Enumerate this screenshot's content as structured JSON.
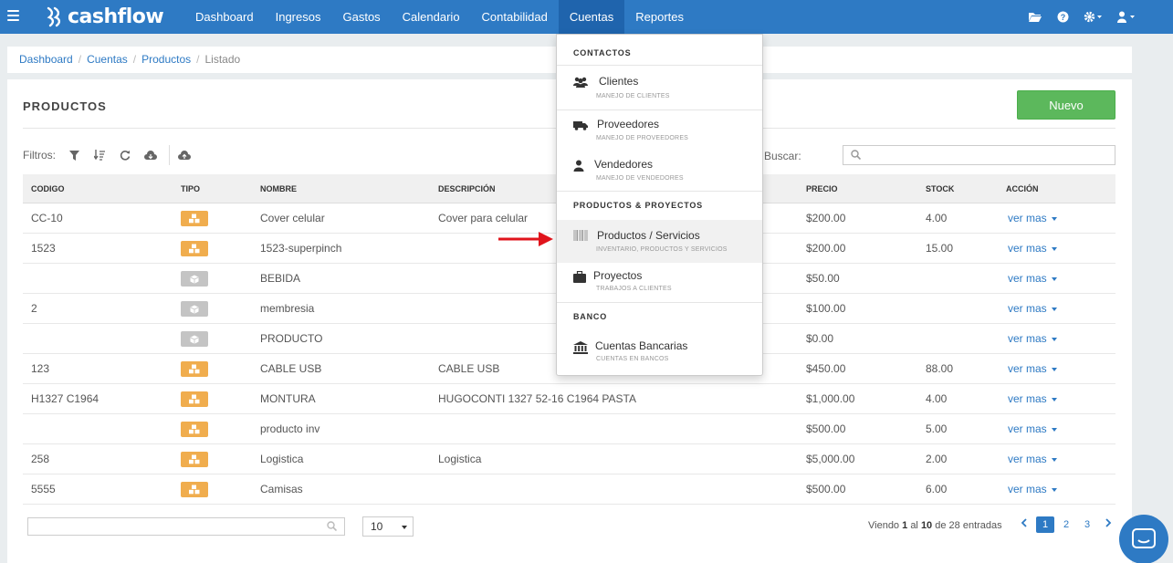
{
  "brand": {
    "name": "cashflow"
  },
  "nav": {
    "items": [
      {
        "label": "Dashboard"
      },
      {
        "label": "Ingresos"
      },
      {
        "label": "Gastos"
      },
      {
        "label": "Calendario"
      },
      {
        "label": "Contabilidad"
      },
      {
        "label": "Cuentas",
        "active": true
      },
      {
        "label": "Reportes"
      }
    ],
    "right_icons": [
      "folder-icon",
      "help-icon",
      "gear-icon",
      "user-icon"
    ]
  },
  "breadcrumb": {
    "items": [
      "Dashboard",
      "Cuentas",
      "Productos"
    ],
    "current": "Listado"
  },
  "panel": {
    "title": "PRODUCTOS",
    "new_button": "Nuevo",
    "filters_label": "Filtros:",
    "search_label": "Buscar:"
  },
  "table": {
    "headers": {
      "codigo": "CODIGO",
      "tipo": "TIPO",
      "nombre": "NOMBRE",
      "descripcion": "DESCRIPCIÓN",
      "precio": "PRECIO",
      "stock": "STOCK",
      "accion": "ACCIÓN"
    },
    "action_label": "ver mas",
    "rows": [
      {
        "codigo": "CC-10",
        "tipo": "product",
        "nombre": "Cover celular",
        "descripcion": "Cover para celular",
        "precio": "$200.00",
        "stock": "4.00"
      },
      {
        "codigo": "1523",
        "tipo": "product",
        "nombre": "1523-superpinch",
        "descripcion": "",
        "precio": "$200.00",
        "stock": "15.00"
      },
      {
        "codigo": "",
        "tipo": "service",
        "nombre": "BEBIDA",
        "descripcion": "",
        "precio": "$50.00",
        "stock": ""
      },
      {
        "codigo": "2",
        "tipo": "service",
        "nombre": "membresia",
        "descripcion": "",
        "precio": "$100.00",
        "stock": ""
      },
      {
        "codigo": "",
        "tipo": "service",
        "nombre": "PRODUCTO",
        "descripcion": "",
        "precio": "$0.00",
        "stock": ""
      },
      {
        "codigo": "123",
        "tipo": "product",
        "nombre": "CABLE USB",
        "descripcion": "CABLE USB",
        "precio": "$450.00",
        "stock": "88.00"
      },
      {
        "codigo": "H1327 C1964",
        "tipo": "product",
        "nombre": "MONTURA",
        "descripcion": "HUGOCONTI 1327 52-16 C1964 PASTA",
        "precio": "$1,000.00",
        "stock": "4.00"
      },
      {
        "codigo": "",
        "tipo": "product",
        "nombre": "producto inv",
        "descripcion": "",
        "precio": "$500.00",
        "stock": "5.00"
      },
      {
        "codigo": "258",
        "tipo": "product",
        "nombre": "Logistica",
        "descripcion": "Logistica",
        "precio": "$5,000.00",
        "stock": "2.00"
      },
      {
        "codigo": "5555",
        "tipo": "product",
        "nombre": "Camisas",
        "descripcion": "",
        "precio": "$500.00",
        "stock": "6.00"
      }
    ]
  },
  "footer": {
    "page_size": "10",
    "info_prefix": "Viendo",
    "info_from": "1",
    "info_mid": "al",
    "info_to": "10",
    "info_suffix": "de 28 entradas",
    "pages": [
      "1",
      "2",
      "3"
    ],
    "current_page": "1"
  },
  "dropdown": {
    "sections": {
      "contactos": "CONTACTOS",
      "productos": "PRODUCTOS & PROYECTOS",
      "banco": "BANCO"
    },
    "items": {
      "clientes": {
        "label": "Clientes",
        "sub": "MANEJO DE CLIENTES"
      },
      "proveedores": {
        "label": "Proveedores",
        "sub": "MANEJO DE PROVEEDORES"
      },
      "vendedores": {
        "label": "Vendedores",
        "sub": "MANEJO DE VENDEDORES"
      },
      "productos": {
        "label": "Productos / Servicios",
        "sub": "INVENTARIO, PRODUCTOS Y SERVICIOS"
      },
      "proyectos": {
        "label": "Proyectos",
        "sub": "TRABAJOS A CLIENTES"
      },
      "cuentas": {
        "label": "Cuentas Bancarias",
        "sub": "CUENTAS EN BANCOS"
      }
    }
  },
  "colors": {
    "primary": "#2e7ac4",
    "success": "#5cb85c",
    "warning": "#f0ad4e",
    "arrow": "#e0141c"
  }
}
